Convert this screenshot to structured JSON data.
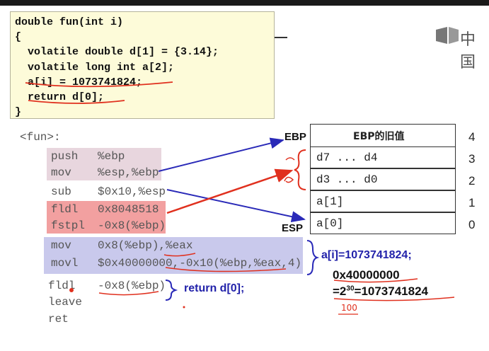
{
  "code": {
    "lines": [
      "double fun(int i)",
      "{",
      "  volatile double d[1] = {3.14};",
      "  volatile long int a[2];",
      "  a[i] = 1073741824;",
      "  return d[0];",
      "}"
    ]
  },
  "logo": {
    "text": "中国"
  },
  "assembly": {
    "func_label": "<fun>:",
    "lines": [
      {
        "op": "push",
        "arg": "%ebp"
      },
      {
        "op": "mov",
        "arg": "%esp,%ebp"
      },
      {
        "op": "sub",
        "arg": "$0x10,%esp"
      },
      {
        "op": "fldl",
        "arg": "0x8048518"
      },
      {
        "op": "fstpl",
        "arg": "-0x8(%ebp)"
      },
      {
        "op": "mov",
        "arg": "0x8(%ebp),%eax"
      },
      {
        "op": "movl",
        "arg": "$0x40000000,-0x10(%ebp,%eax,4)"
      },
      {
        "op": "fldl",
        "arg": "-0x8(%ebp)"
      },
      {
        "op": "leave",
        "arg": ""
      },
      {
        "op": "ret",
        "arg": ""
      }
    ]
  },
  "stack": {
    "ebp_label": "EBP",
    "esp_label": "ESP",
    "cells": [
      {
        "text": "EBP的旧值",
        "index": "4"
      },
      {
        "text": "d7 ... d4",
        "index": "3"
      },
      {
        "text": "d3 ... d0",
        "index": "2"
      },
      {
        "text": "a[1]",
        "index": "1"
      },
      {
        "text": "a[0]",
        "index": "0"
      }
    ]
  },
  "annotations": {
    "return_note": "return d[0];",
    "assign_note": "a[i]=1073741824;",
    "hex_value": "0x40000000",
    "power_prefix": "=2",
    "power_exp": "30",
    "power_suffix": "=1073741824",
    "handwritten": "100"
  },
  "colors": {
    "highlight_pink": "#e8d6de",
    "highlight_red": "#f2a0a0",
    "highlight_blue": "#c9c9ec",
    "arrow_blue": "#2a2ab8",
    "arrow_red": "#e0301e",
    "code_bg": "#fdfbd9"
  }
}
